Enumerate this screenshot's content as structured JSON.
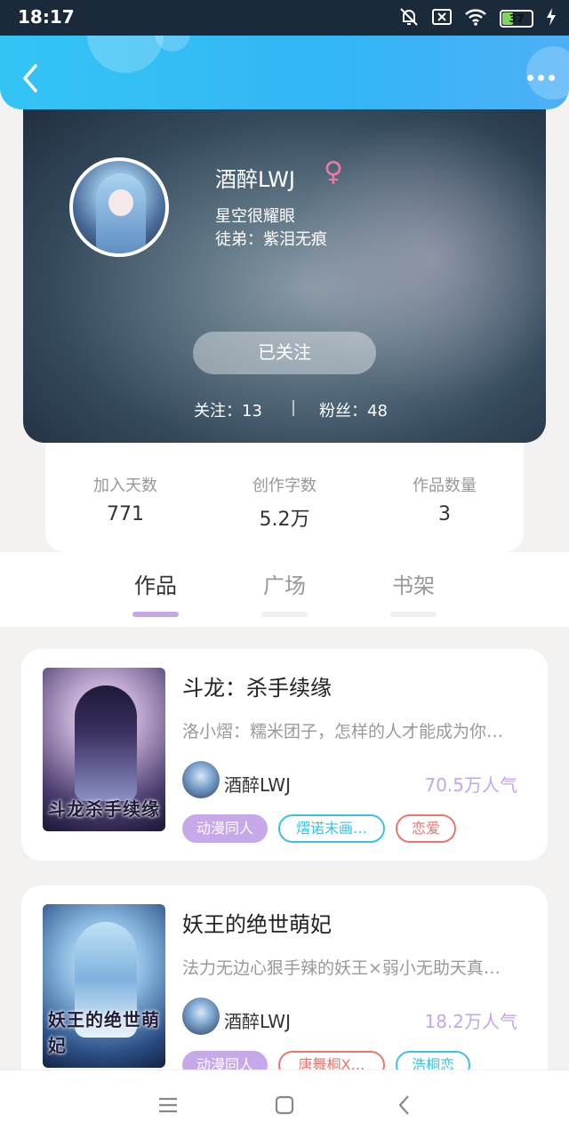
{
  "status_bar": {
    "time": "18:17",
    "battery": "37",
    "battery_level": 0.37,
    "icons": [
      "mute-icon",
      "sim-x-icon",
      "wifi-icon",
      "battery-icon",
      "charging-icon"
    ]
  },
  "header": {
    "back_icon": "chevron-left-icon",
    "more_icon": "more-dots-icon"
  },
  "profile": {
    "nickname": "酒醉LWJ",
    "gender_symbol": "♀",
    "signature": "星空很耀眼",
    "apprentice": "徒弟：紫泪无痕",
    "follow_button": "已关注",
    "following": "关注：13",
    "fans": "粉丝：48"
  },
  "stats": [
    {
      "label": "加入天数",
      "value": "771"
    },
    {
      "label": "创作字数",
      "value": "5.2万"
    },
    {
      "label": "作品数量",
      "value": "3"
    }
  ],
  "tabs": [
    {
      "label": "作品",
      "active": true
    },
    {
      "label": "广场",
      "active": false
    },
    {
      "label": "书架",
      "active": false
    }
  ],
  "works": [
    {
      "title": "斗龙：杀手续缘",
      "desc": "洛小熠：糯米团子，怎样的人才能成为你…",
      "cover_text": "斗龙杀手续缘",
      "author": "酒醉LWJ",
      "popularity": "70.5万人气",
      "tags": [
        "动漫同人",
        "熠诺末画…",
        "恋爱"
      ]
    },
    {
      "title": "妖王的绝世萌妃",
      "desc": "法力无边心狠手辣的妖王×弱小无助天真…",
      "cover_text": "妖王的绝世萌妃",
      "author": "酒醉LWJ",
      "popularity": "18.2万人气",
      "tags": [
        "动漫同人",
        "唐舞桐X…",
        "浩桐恋"
      ]
    }
  ],
  "colors": {
    "header_blue": "#34c4f4",
    "accent_purple": "#c5a6e6",
    "tag_cyan": "#3dc1dc",
    "tag_red": "#e7766f",
    "gender_pink": "#f07aa6"
  },
  "nav_bar": {
    "icons": [
      "menu-icon",
      "home-square-icon",
      "back-triangle-icon"
    ]
  }
}
